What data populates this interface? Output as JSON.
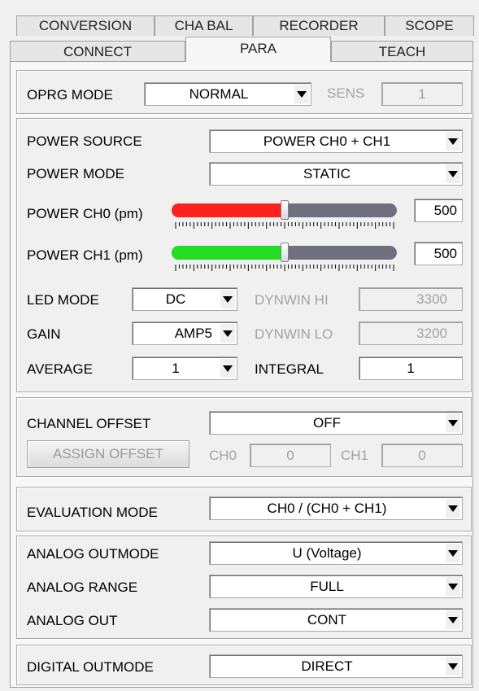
{
  "tabs_row1": [
    "CONVERSION",
    "CHA BAL",
    "RECORDER",
    "SCOPE"
  ],
  "tabs_row2": [
    "CONNECT",
    "PARA",
    "TEACH"
  ],
  "active_tab": "PARA",
  "oprg": {
    "label": "OPRG MODE",
    "value": "NORMAL",
    "sens_label": "SENS",
    "sens_value": "1"
  },
  "power": {
    "source_label": "POWER SOURCE",
    "source_value": "POWER CH0 + CH1",
    "mode_label": "POWER MODE",
    "mode_value": "STATIC",
    "ch0_label": "POWER CH0 (pm)",
    "ch0_value": "500",
    "ch0_color": "#ff2020",
    "ch1_label": "POWER CH1 (pm)",
    "ch1_value": "500",
    "ch1_color": "#22dd22",
    "slider_level": 0.5
  },
  "led": {
    "label": "LED MODE",
    "value": "DC",
    "dynwin_hi_label": "DYNWIN HI",
    "dynwin_hi_value": "3300"
  },
  "gain": {
    "label": "GAIN",
    "value": "AMP5",
    "dynwin_lo_label": "DYNWIN LO",
    "dynwin_lo_value": "3200"
  },
  "average": {
    "label": "AVERAGE",
    "value": "1",
    "integral_label": "INTEGRAL",
    "integral_value": "1"
  },
  "offset": {
    "label": "CHANNEL OFFSET",
    "value": "OFF",
    "assign_button": "ASSIGN OFFSET",
    "ch0_label": "CH0",
    "ch0_value": "0",
    "ch1_label": "CH1",
    "ch1_value": "0"
  },
  "evaluation": {
    "label": "EVALUATION MODE",
    "value": "CH0 / (CH0 + CH1)"
  },
  "analog": {
    "outmode_label": "ANALOG OUTMODE",
    "outmode_value": "U (Voltage)",
    "range_label": "ANALOG RANGE",
    "range_value": "FULL",
    "out_label": "ANALOG OUT",
    "out_value": "CONT"
  },
  "digital": {
    "label": "DIGITAL OUTMODE",
    "value": "DIRECT"
  }
}
